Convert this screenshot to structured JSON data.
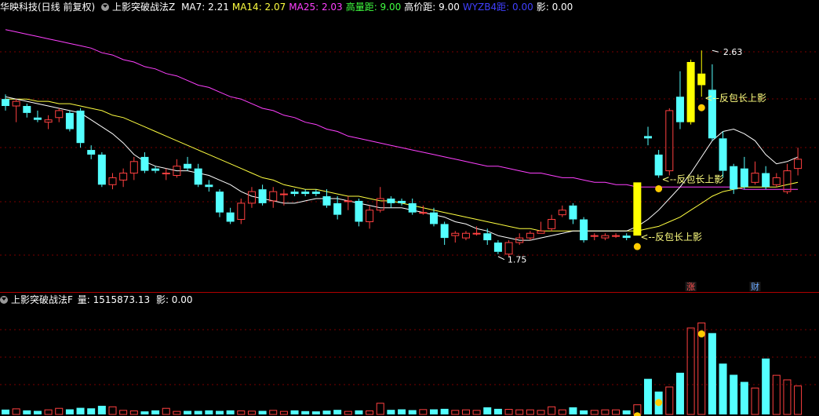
{
  "header": {
    "stock": "华映科技(日线 前复权)",
    "indicator": "上影突破战法Z",
    "items": [
      {
        "label": "MA7: 2.21",
        "color": "#ffffff"
      },
      {
        "label": "MA14: 2.07",
        "color": "#ffff40"
      },
      {
        "label": "MA25: 2.03",
        "color": "#ff40ff"
      },
      {
        "label": "高量距: 9.00",
        "color": "#40ff40"
      },
      {
        "label": "高价距: 9.00",
        "color": "#ffffff"
      },
      {
        "label": "WYZB4距: 0.00",
        "color": "#4040ff"
      },
      {
        "label": "影: 0.00",
        "color": "#ffffff"
      }
    ]
  },
  "vol_header": {
    "indicator": "上影突破战法F",
    "volume_label": "量: 1515873.13",
    "shadow_label": "影: 0.00"
  },
  "chart_data": {
    "type": "candlestick",
    "ylim": [
      1.6,
      2.78
    ],
    "volume_max": 2100000,
    "colors": {
      "up": "#ff4040",
      "down": "#54ffff",
      "ma7": "#ffffff",
      "ma14": "#ffff40",
      "ma25": "#ff40ff",
      "signal_bar": "#ffff00",
      "marker": "#ffcc00",
      "label": "#ffff80",
      "grid": "#7a0000"
    },
    "ohlc": [
      [
        2.42,
        2.44,
        2.37,
        2.39
      ],
      [
        2.39,
        2.42,
        2.32,
        2.41
      ],
      [
        2.39,
        2.4,
        2.34,
        2.36
      ],
      [
        2.34,
        2.37,
        2.32,
        2.33
      ],
      [
        2.32,
        2.35,
        2.29,
        2.33
      ],
      [
        2.34,
        2.38,
        2.32,
        2.37
      ],
      [
        2.36,
        2.37,
        2.28,
        2.29
      ],
      [
        2.37,
        2.38,
        2.21,
        2.23
      ],
      [
        2.2,
        2.22,
        2.16,
        2.18
      ],
      [
        2.18,
        2.19,
        2.04,
        2.05
      ],
      [
        2.05,
        2.1,
        2.03,
        2.08
      ],
      [
        2.07,
        2.12,
        2.04,
        2.1
      ],
      [
        2.1,
        2.17,
        2.07,
        2.15
      ],
      [
        2.17,
        2.19,
        2.1,
        2.11
      ],
      [
        2.12,
        2.13,
        2.1,
        2.11
      ],
      [
        2.1,
        2.12,
        2.07,
        2.1
      ],
      [
        2.09,
        2.16,
        2.08,
        2.13
      ],
      [
        2.14,
        2.17,
        2.11,
        2.12
      ],
      [
        2.12,
        2.14,
        2.04,
        2.05
      ],
      [
        2.05,
        2.07,
        2.02,
        2.04
      ],
      [
        2.02,
        2.03,
        1.91,
        1.93
      ],
      [
        1.93,
        1.95,
        1.88,
        1.89
      ],
      [
        1.9,
        1.99,
        1.88,
        1.97
      ],
      [
        1.97,
        2.04,
        1.95,
        2.02
      ],
      [
        2.03,
        2.05,
        1.96,
        1.97
      ],
      [
        1.98,
        2.04,
        1.95,
        2.02
      ],
      [
        2.01,
        2.03,
        1.96,
        2.01
      ],
      [
        2.02,
        2.03,
        2.0,
        2.01
      ],
      [
        2.02,
        2.03,
        2.0,
        2.01
      ],
      [
        2.02,
        2.03,
        2.0,
        2.01
      ],
      [
        2.0,
        2.03,
        1.95,
        1.96
      ],
      [
        1.97,
        2.0,
        1.9,
        1.92
      ],
      [
        1.98,
        2.0,
        1.94,
        1.98
      ],
      [
        1.98,
        1.99,
        1.87,
        1.89
      ],
      [
        1.89,
        1.96,
        1.86,
        1.94
      ],
      [
        1.94,
        2.04,
        1.93,
        1.99
      ],
      [
        1.99,
        2.0,
        1.95,
        1.97
      ],
      [
        1.98,
        1.99,
        1.96,
        1.97
      ],
      [
        1.97,
        1.99,
        1.92,
        1.93
      ],
      [
        1.93,
        1.96,
        1.92,
        1.93
      ],
      [
        1.93,
        1.95,
        1.87,
        1.88
      ],
      [
        1.88,
        1.89,
        1.79,
        1.82
      ],
      [
        1.83,
        1.85,
        1.8,
        1.84
      ],
      [
        1.82,
        1.85,
        1.81,
        1.84
      ],
      [
        1.84,
        1.87,
        1.83,
        1.84
      ],
      [
        1.84,
        1.86,
        1.79,
        1.81
      ],
      [
        1.8,
        1.81,
        1.75,
        1.76
      ],
      [
        1.75,
        1.81,
        1.74,
        1.8
      ],
      [
        1.8,
        1.84,
        1.79,
        1.82
      ],
      [
        1.82,
        1.85,
        1.81,
        1.84
      ],
      [
        1.84,
        1.89,
        1.84,
        1.85
      ],
      [
        1.86,
        1.92,
        1.85,
        1.9
      ],
      [
        1.92,
        1.96,
        1.91,
        1.94
      ],
      [
        1.96,
        1.97,
        1.88,
        1.9
      ],
      [
        1.9,
        1.91,
        1.8,
        1.81
      ],
      [
        1.83,
        1.84,
        1.81,
        1.83
      ],
      [
        1.82,
        1.84,
        1.81,
        1.83
      ],
      [
        1.83,
        1.84,
        1.82,
        1.83
      ],
      [
        1.83,
        1.84,
        1.81,
        1.82
      ],
      [
        1.83,
        2.06,
        1.83,
        2.06
      ],
      [
        2.26,
        2.3,
        2.22,
        2.25
      ],
      [
        2.18,
        2.2,
        2.08,
        2.09
      ],
      [
        2.11,
        2.38,
        2.09,
        2.37
      ],
      [
        2.43,
        2.54,
        2.29,
        2.32
      ],
      [
        2.32,
        2.59,
        2.31,
        2.58
      ],
      [
        2.48,
        2.63,
        2.43,
        2.53
      ],
      [
        2.46,
        2.57,
        2.24,
        2.25
      ],
      [
        2.25,
        2.28,
        2.08,
        2.11
      ],
      [
        2.13,
        2.14,
        2.01,
        2.03
      ],
      [
        2.12,
        2.17,
        2.03,
        2.04
      ],
      [
        2.06,
        2.15,
        2.05,
        2.1
      ],
      [
        2.1,
        2.13,
        2.03,
        2.04
      ],
      [
        2.05,
        2.1,
        2.04,
        2.08
      ],
      [
        2.02,
        2.14,
        2.01,
        2.11
      ],
      [
        2.12,
        2.21,
        2.09,
        2.16
      ]
    ],
    "ma7": [
      2.43,
      2.42,
      2.41,
      2.4,
      2.39,
      2.38,
      2.37,
      2.36,
      2.33,
      2.3,
      2.27,
      2.23,
      2.18,
      2.15,
      2.13,
      2.12,
      2.11,
      2.11,
      2.1,
      2.09,
      2.07,
      2.05,
      2.02,
      2.0,
      1.99,
      1.98,
      1.97,
      1.97,
      1.98,
      1.99,
      1.99,
      1.99,
      1.98,
      1.97,
      1.96,
      1.95,
      1.95,
      1.95,
      1.94,
      1.93,
      1.92,
      1.91,
      1.89,
      1.88,
      1.86,
      1.85,
      1.83,
      1.82,
      1.81,
      1.81,
      1.82,
      1.83,
      1.84,
      1.85,
      1.85,
      1.85,
      1.85,
      1.85,
      1.85,
      1.87,
      1.9,
      1.94,
      1.99,
      2.04,
      2.1,
      2.17,
      2.24,
      2.28,
      2.29,
      2.27,
      2.24,
      2.18,
      2.14,
      2.15,
      2.17
    ],
    "ma14": [
      2.42,
      2.42,
      2.42,
      2.41,
      2.41,
      2.4,
      2.4,
      2.39,
      2.38,
      2.37,
      2.35,
      2.34,
      2.32,
      2.3,
      2.28,
      2.26,
      2.24,
      2.22,
      2.2,
      2.18,
      2.16,
      2.14,
      2.12,
      2.1,
      2.08,
      2.07,
      2.05,
      2.04,
      2.03,
      2.03,
      2.02,
      2.01,
      2.0,
      2.0,
      1.99,
      1.98,
      1.98,
      1.97,
      1.96,
      1.95,
      1.94,
      1.93,
      1.92,
      1.91,
      1.9,
      1.89,
      1.88,
      1.87,
      1.86,
      1.86,
      1.85,
      1.85,
      1.85,
      1.85,
      1.85,
      1.85,
      1.85,
      1.85,
      1.85,
      1.85,
      1.86,
      1.87,
      1.89,
      1.91,
      1.94,
      1.97,
      2.0,
      2.02,
      2.03,
      2.04,
      2.04,
      2.04,
      2.04,
      2.05,
      2.06
    ],
    "ma25": [
      2.72,
      2.71,
      2.7,
      2.69,
      2.68,
      2.67,
      2.66,
      2.65,
      2.64,
      2.62,
      2.61,
      2.59,
      2.58,
      2.56,
      2.55,
      2.53,
      2.52,
      2.5,
      2.48,
      2.47,
      2.45,
      2.43,
      2.42,
      2.4,
      2.38,
      2.37,
      2.35,
      2.34,
      2.32,
      2.31,
      2.29,
      2.28,
      2.26,
      2.25,
      2.24,
      2.23,
      2.22,
      2.21,
      2.2,
      2.19,
      2.18,
      2.17,
      2.16,
      2.15,
      2.14,
      2.13,
      2.13,
      2.12,
      2.11,
      2.1,
      2.1,
      2.09,
      2.08,
      2.08,
      2.07,
      2.06,
      2.06,
      2.05,
      2.05,
      2.04,
      2.04,
      2.04,
      2.04,
      2.04,
      2.04,
      2.04,
      2.04,
      2.04,
      2.04,
      2.03,
      2.03,
      2.03,
      2.03,
      2.03,
      2.03
    ],
    "volume": [
      95000,
      110000,
      80000,
      70000,
      90000,
      120000,
      100000,
      130000,
      120000,
      170000,
      150000,
      80000,
      70000,
      60000,
      80000,
      120000,
      60000,
      70000,
      70000,
      80000,
      70000,
      80000,
      70000,
      65000,
      70000,
      80000,
      60000,
      80000,
      65000,
      60000,
      75000,
      90000,
      60000,
      80000,
      70000,
      220000,
      90000,
      100000,
      85000,
      95000,
      100000,
      110000,
      80000,
      90000,
      80000,
      140000,
      110000,
      100000,
      90000,
      90000,
      80000,
      150000,
      90000,
      140000,
      80000,
      80000,
      90000,
      90000,
      80000,
      190000,
      700000,
      450000,
      540000,
      820000,
      1700000,
      1800000,
      1600000,
      1000000,
      780000,
      640000,
      520000,
      1100000,
      770000,
      680000,
      560000
    ],
    "signal_bars": [
      59,
      64,
      65
    ],
    "markers": [
      {
        "i": 59,
        "label": "<--反包长上影"
      },
      {
        "i": 61,
        "label": "<--反包长上影"
      },
      {
        "i": 65,
        "label": "<--反包长上影"
      }
    ],
    "volume_markers": [
      59,
      61,
      65
    ],
    "annotations": [
      {
        "i": 66,
        "price": 2.63,
        "label": "2.63",
        "kind": "high"
      },
      {
        "i": 46,
        "price": 1.74,
        "label": "1.75",
        "kind": "low"
      }
    ],
    "tags": [
      {
        "i": 64,
        "label": "涨",
        "color": "#ff5050"
      },
      {
        "i": 70,
        "label": "财",
        "color": "#6aa8ff"
      }
    ]
  }
}
